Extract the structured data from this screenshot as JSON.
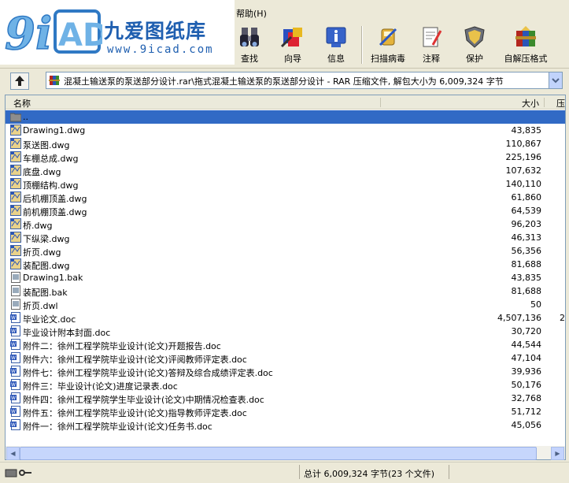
{
  "menu": {
    "help": "帮助(H)"
  },
  "logo": {
    "mark": "9iCAD",
    "title": "九爱图纸库",
    "url": "www.9icad.com"
  },
  "toolbar": [
    {
      "name": "find",
      "label": "查找",
      "icon": "binoculars-icon"
    },
    {
      "name": "wizard",
      "label": "向导",
      "icon": "wizard-icon"
    },
    {
      "name": "info",
      "label": "信息",
      "icon": "info-icon"
    },
    {
      "name": "virus-scan",
      "label": "扫描病毒",
      "icon": "virus-scan-icon"
    },
    {
      "name": "comment",
      "label": "注释",
      "icon": "comment-icon"
    },
    {
      "name": "protect",
      "label": "保护",
      "icon": "shield-icon"
    },
    {
      "name": "sfx",
      "label": "自解压格式",
      "icon": "sfx-icon"
    }
  ],
  "address": {
    "path": "混凝土输送泵的泵送部分设计.rar\\拖式混凝土输送泵的泵送部分设计 - RAR 压缩文件, 解包大小为 6,009,324 字节"
  },
  "columns": {
    "name": "名称",
    "size": "大小",
    "packed": "压"
  },
  "files": [
    {
      "name": "..",
      "size": "",
      "type": "folder"
    },
    {
      "name": "Drawing1.dwg",
      "size": "43,835",
      "type": "dwg"
    },
    {
      "name": "泵送图.dwg",
      "size": "110,867",
      "type": "dwg"
    },
    {
      "name": "车棚总成.dwg",
      "size": "225,196",
      "type": "dwg"
    },
    {
      "name": "底盘.dwg",
      "size": "107,632",
      "type": "dwg"
    },
    {
      "name": "顶棚结构.dwg",
      "size": "140,110",
      "type": "dwg"
    },
    {
      "name": "后机棚顶盖.dwg",
      "size": "61,860",
      "type": "dwg"
    },
    {
      "name": "前机棚顶盖.dwg",
      "size": "64,539",
      "type": "dwg"
    },
    {
      "name": "桥.dwg",
      "size": "96,203",
      "type": "dwg"
    },
    {
      "name": "下纵梁.dwg",
      "size": "46,313",
      "type": "dwg"
    },
    {
      "name": "折页.dwg",
      "size": "56,356",
      "type": "dwg"
    },
    {
      "name": "装配图.dwg",
      "size": "81,688",
      "type": "dwg"
    },
    {
      "name": "Drawing1.bak",
      "size": "43,835",
      "type": "bak"
    },
    {
      "name": "装配图.bak",
      "size": "81,688",
      "type": "bak"
    },
    {
      "name": "折页.dwl",
      "size": "50",
      "type": "bak"
    },
    {
      "name": "毕业论文.doc",
      "size": "4,507,136",
      "type": "doc",
      "extra": "2"
    },
    {
      "name": "毕业设计附本封面.doc",
      "size": "30,720",
      "type": "doc"
    },
    {
      "name": "附件二：徐州工程学院毕业设计(论文)开题报告.doc",
      "size": "44,544",
      "type": "doc"
    },
    {
      "name": "附件六：徐州工程学院毕业设计(论文)评阅教师评定表.doc",
      "size": "47,104",
      "type": "doc"
    },
    {
      "name": "附件七：徐州工程学院毕业设计(论文)答辩及综合成绩评定表.doc",
      "size": "39,936",
      "type": "doc"
    },
    {
      "name": "附件三：毕业设计(论文)进度记录表.doc",
      "size": "50,176",
      "type": "doc"
    },
    {
      "name": "附件四：徐州工程学院学生毕业设计(论文)中期情况检查表.doc",
      "size": "32,768",
      "type": "doc"
    },
    {
      "name": "附件五：徐州工程学院毕业设计(论文)指导教师评定表.doc",
      "size": "51,712",
      "type": "doc"
    },
    {
      "name": "附件一：徐州工程学院毕业设计(论文)任务书.doc",
      "size": "45,056",
      "type": "doc"
    }
  ],
  "status": {
    "total": "总计 6,009,324 字节(23 个文件)"
  },
  "colors": {
    "selection": "#316ac5",
    "toolbar_bg": "#ece9d8"
  }
}
